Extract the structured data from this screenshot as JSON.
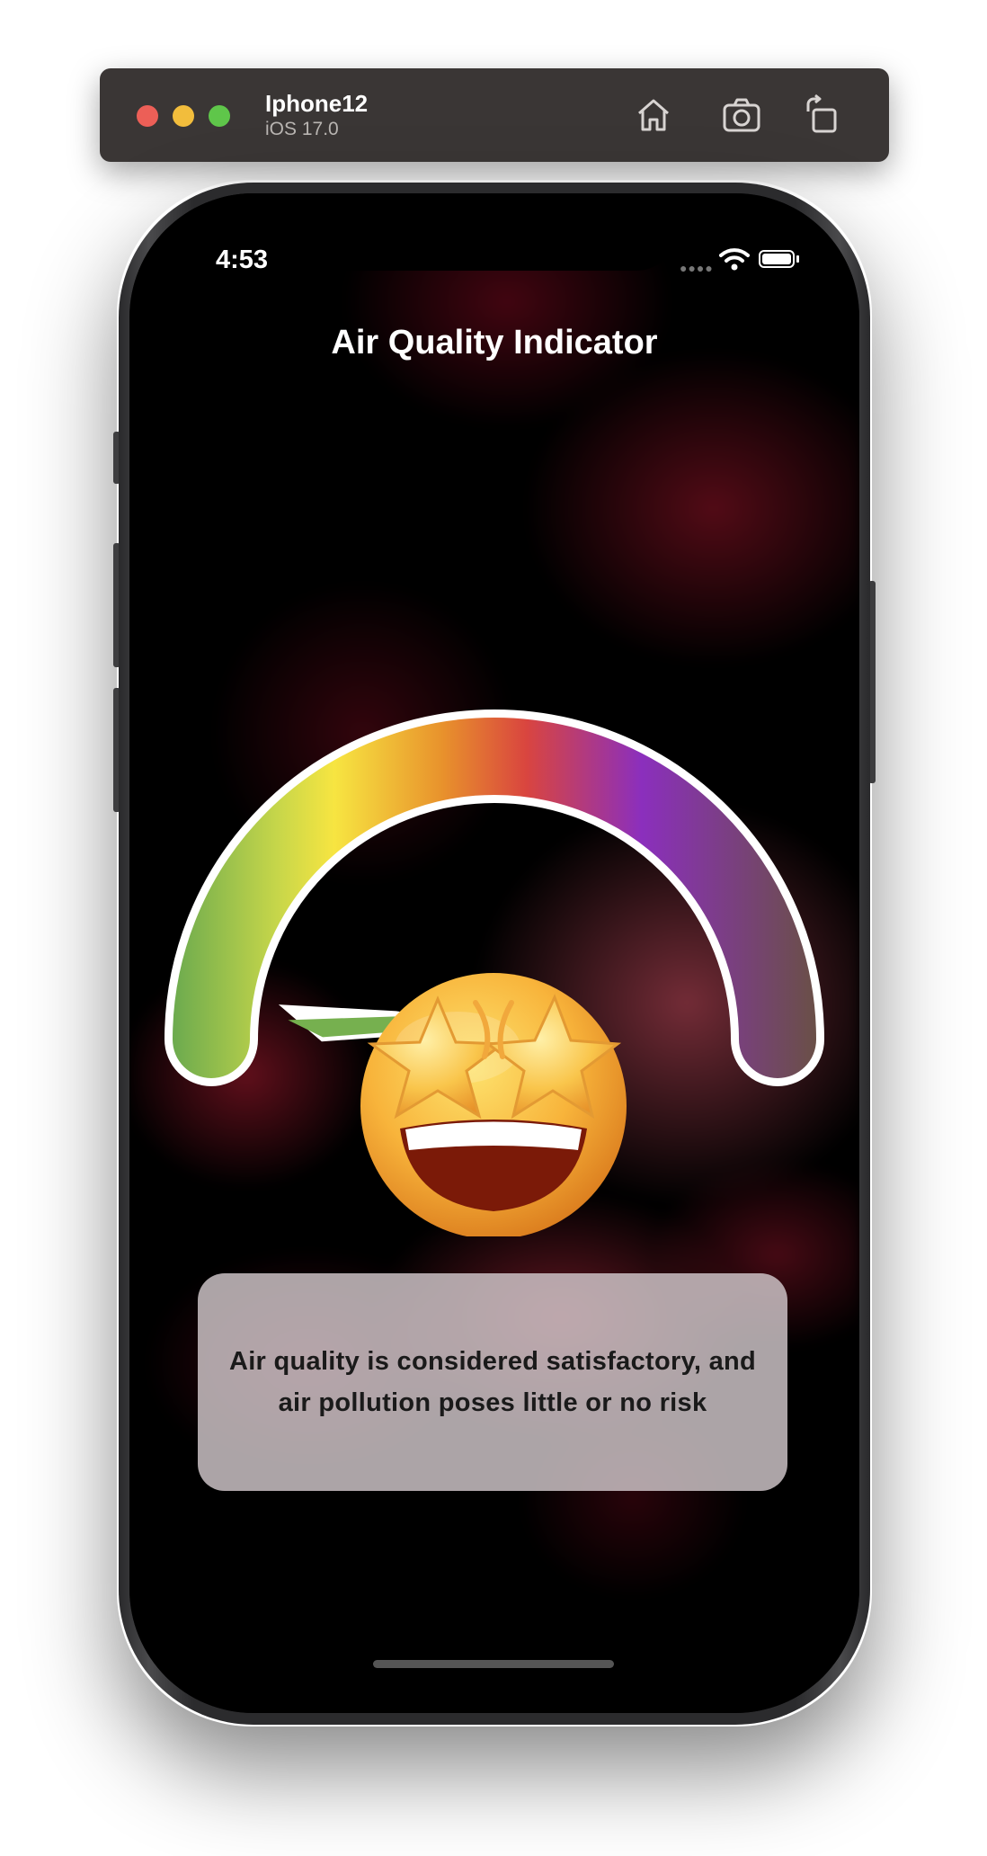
{
  "simulator": {
    "device_name": "Iphone12",
    "os_version": "iOS 17.0",
    "icons": [
      "home-icon",
      "screenshot-icon",
      "rotate-icon"
    ]
  },
  "status_bar": {
    "time": "4:53",
    "icons": [
      "wifi-icon",
      "battery-icon"
    ]
  },
  "app": {
    "title": "Air Quality Indicator",
    "gauge": {
      "needle_level": 0.03,
      "gradient_colors": [
        "#6dab4e",
        "#c6d64a",
        "#f7e541",
        "#e8912c",
        "#d9453f",
        "#8b2fbd",
        "#6a4f48"
      ]
    },
    "emoji": "star-struck-emoji",
    "message": "Air quality is considered satisfactory, and air pollution poses little or no risk"
  }
}
